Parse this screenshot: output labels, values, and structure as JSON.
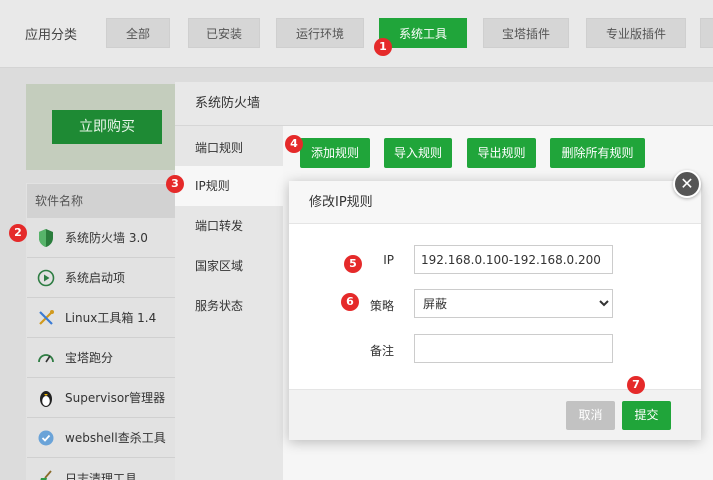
{
  "topbar": {
    "label": "应用分类",
    "categories": [
      "全部",
      "已安装",
      "运行环境",
      "系统工具",
      "宝塔插件",
      "专业版插件"
    ]
  },
  "promo": {
    "buy_label": "立即购买"
  },
  "software": {
    "header": "软件名称",
    "items": [
      {
        "name": "系统防火墙 3.0",
        "icon": "shield-icon"
      },
      {
        "name": "系统启动项",
        "icon": "play-icon"
      },
      {
        "name": "Linux工具箱 1.4",
        "icon": "wrench-icon"
      },
      {
        "name": "宝塔跑分",
        "icon": "gauge-icon"
      },
      {
        "name": "Supervisor管理器",
        "icon": "penguin-icon"
      },
      {
        "name": "webshell查杀工具",
        "icon": "shield-check-icon"
      },
      {
        "name": "日志清理工具",
        "icon": "broom-icon"
      }
    ]
  },
  "firewall": {
    "title": "系统防火墙",
    "menu": [
      "端口规则",
      "IP规则",
      "端口转发",
      "国家区域",
      "服务状态"
    ],
    "actions": [
      "添加规则",
      "导入规则",
      "导出规则",
      "删除所有规则"
    ]
  },
  "dialog": {
    "title": "修改IP规则",
    "ip_label": "IP",
    "ip_value": "192.168.0.100-192.168.0.200",
    "policy_label": "策略",
    "policy_value": "屏蔽",
    "note_label": "备注",
    "note_value": "",
    "cancel_label": "取消",
    "submit_label": "提交",
    "close_glyph": "✕"
  },
  "markers": [
    "1",
    "2",
    "3",
    "4",
    "5",
    "6",
    "7"
  ],
  "colors": {
    "accent": "#20a53a",
    "marker": "#e52a2a"
  }
}
